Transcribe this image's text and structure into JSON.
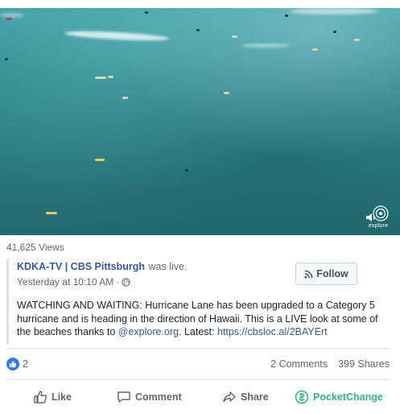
{
  "video": {
    "watermark": "explore"
  },
  "stats": {
    "views": "41,625 Views"
  },
  "shared_post": {
    "page_name": "KDKA-TV | CBS Pittsburgh",
    "status": "was live.",
    "timestamp": "Yesterday at 10:10 AM",
    "separator": "·",
    "follow_label": "Follow",
    "text_main": "WATCHING AND WAITING: Hurricane Lane has been upgraded to a Category 5 hurricane and is heading in the direction of Hawaii. This is a LIVE look at some of the beaches thanks to ",
    "mention": "@explore.org",
    "text_after_mention": ". Latest: ",
    "link": "https://cbsloc.al/2BAYErt"
  },
  "reactions": {
    "likes": "2",
    "comments": "2 Comments",
    "shares": "399 Shares"
  },
  "actions": {
    "like": "Like",
    "comment": "Comment",
    "share": "Share",
    "pocket": "PocketChange"
  },
  "colors": {
    "accent": "#365899",
    "like_badge": "#2d7bf4",
    "pocket": "#2fb67c"
  }
}
